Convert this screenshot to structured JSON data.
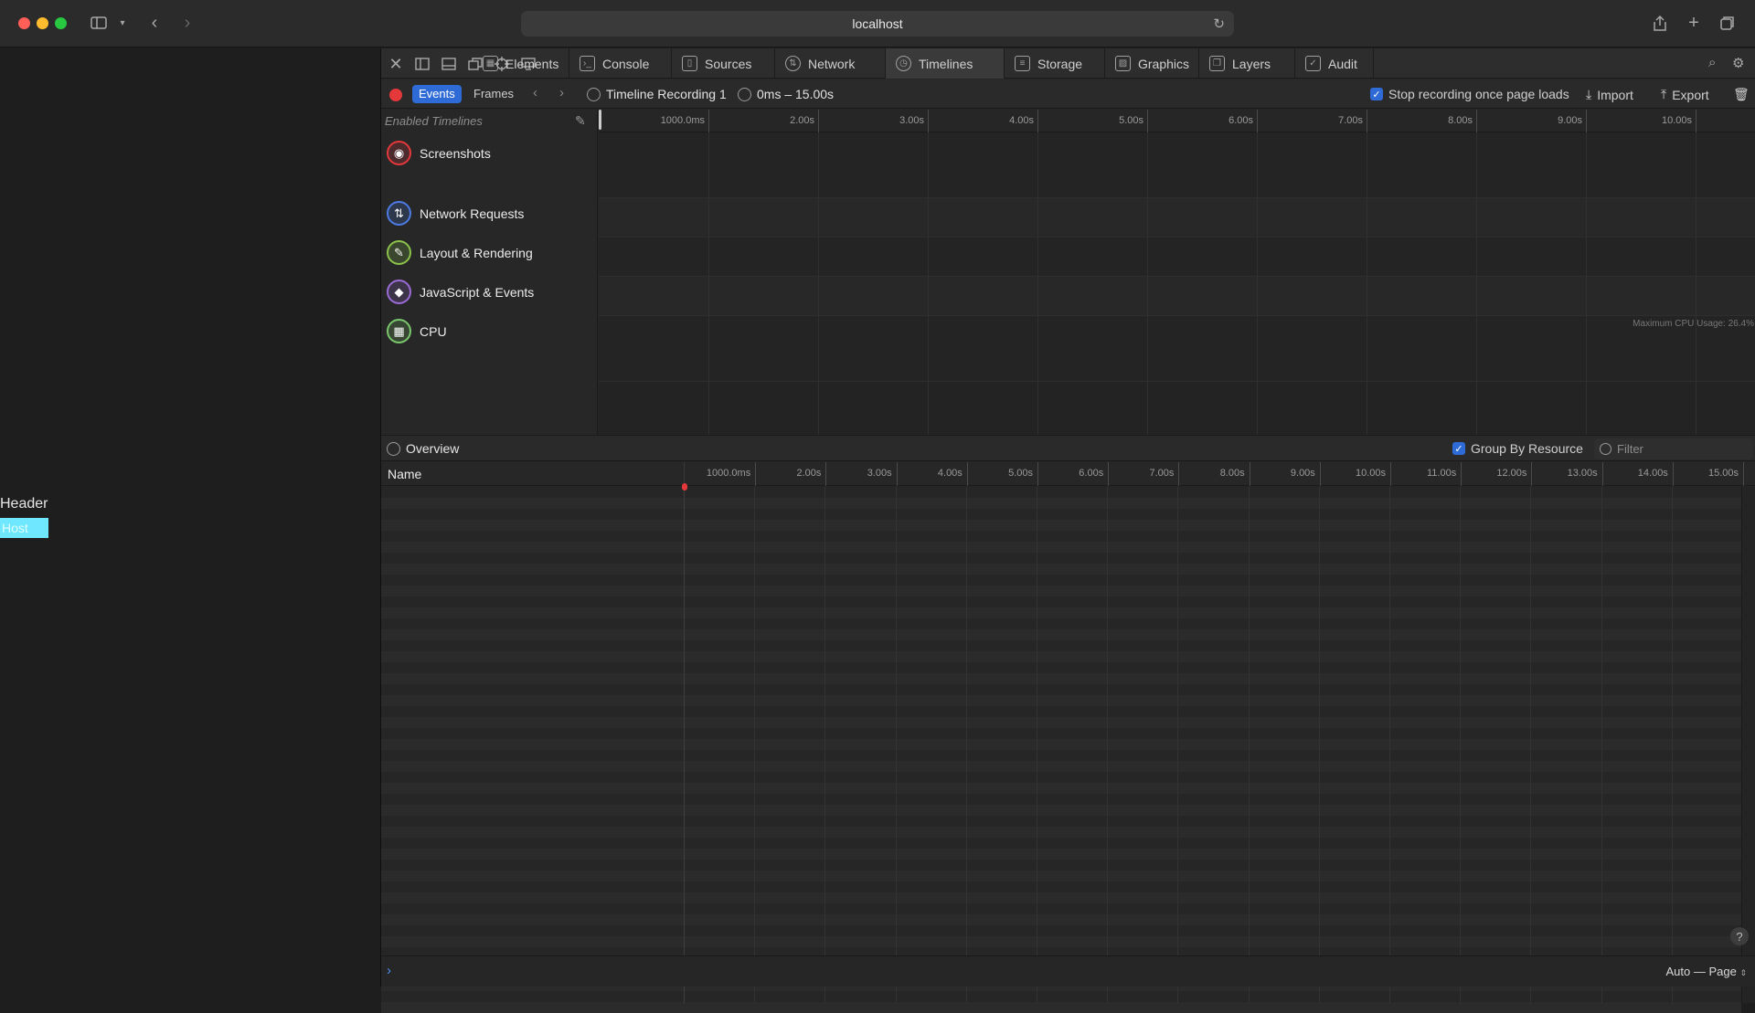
{
  "browser": {
    "url": "localhost",
    "colors": {
      "close": "#ff5f57",
      "minimize": "#febc2e",
      "zoom": "#28c840"
    }
  },
  "page": {
    "header_text": "Header",
    "host_text": "Host"
  },
  "devtools": {
    "tabs": [
      {
        "label": "Elements",
        "icon": "elements-icon"
      },
      {
        "label": "Console",
        "icon": "console-icon"
      },
      {
        "label": "Sources",
        "icon": "sources-icon"
      },
      {
        "label": "Network",
        "icon": "network-icon"
      },
      {
        "label": "Timelines",
        "icon": "timelines-icon",
        "active": true
      },
      {
        "label": "Storage",
        "icon": "storage-icon"
      },
      {
        "label": "Graphics",
        "icon": "graphics-icon"
      },
      {
        "label": "Layers",
        "icon": "layers-icon"
      },
      {
        "label": "Audit",
        "icon": "audit-icon"
      }
    ],
    "recording_bar": {
      "events_label": "Events",
      "frames_label": "Frames",
      "recording_name": "Timeline Recording 1",
      "time_range": "0ms – 15.00s",
      "stop_recording_label": "Stop recording once page loads",
      "stop_recording_checked": true,
      "import_label": "Import",
      "export_label": "Export"
    },
    "timelines": {
      "enabled_label": "Enabled Timelines",
      "items": [
        {
          "label": "Screenshots",
          "icon": "camera-icon",
          "color": "#e5383b"
        },
        {
          "label": "Network Requests",
          "icon": "network-arrows-icon",
          "color": "#4d7be6"
        },
        {
          "label": "Layout & Rendering",
          "icon": "paintbrush-icon",
          "color": "#8bc34a"
        },
        {
          "label": "JavaScript & Events",
          "icon": "code-diamond-icon",
          "color": "#9b6bd6"
        },
        {
          "label": "CPU",
          "icon": "cpu-chip-icon",
          "color": "#7ac86b"
        }
      ],
      "ruler_ticks": [
        "1000.0ms",
        "2.00s",
        "3.00s",
        "4.00s",
        "5.00s",
        "6.00s",
        "7.00s",
        "8.00s",
        "9.00s",
        "10.00s"
      ],
      "cpu_max_label": "Maximum CPU Usage: 26.4%"
    },
    "overview": {
      "title": "Overview",
      "group_by_resource_label": "Group By Resource",
      "group_by_resource_checked": true,
      "filter_placeholder": "Filter"
    },
    "table": {
      "name_header": "Name",
      "ruler_ticks": [
        "1000.0ms",
        "2.00s",
        "3.00s",
        "4.00s",
        "5.00s",
        "6.00s",
        "7.00s",
        "8.00s",
        "9.00s",
        "10.00s",
        "11.00s",
        "12.00s",
        "13.00s",
        "14.00s",
        "15.00s"
      ]
    },
    "footer": {
      "help_label": "?",
      "context_label": "Auto — Page"
    }
  }
}
